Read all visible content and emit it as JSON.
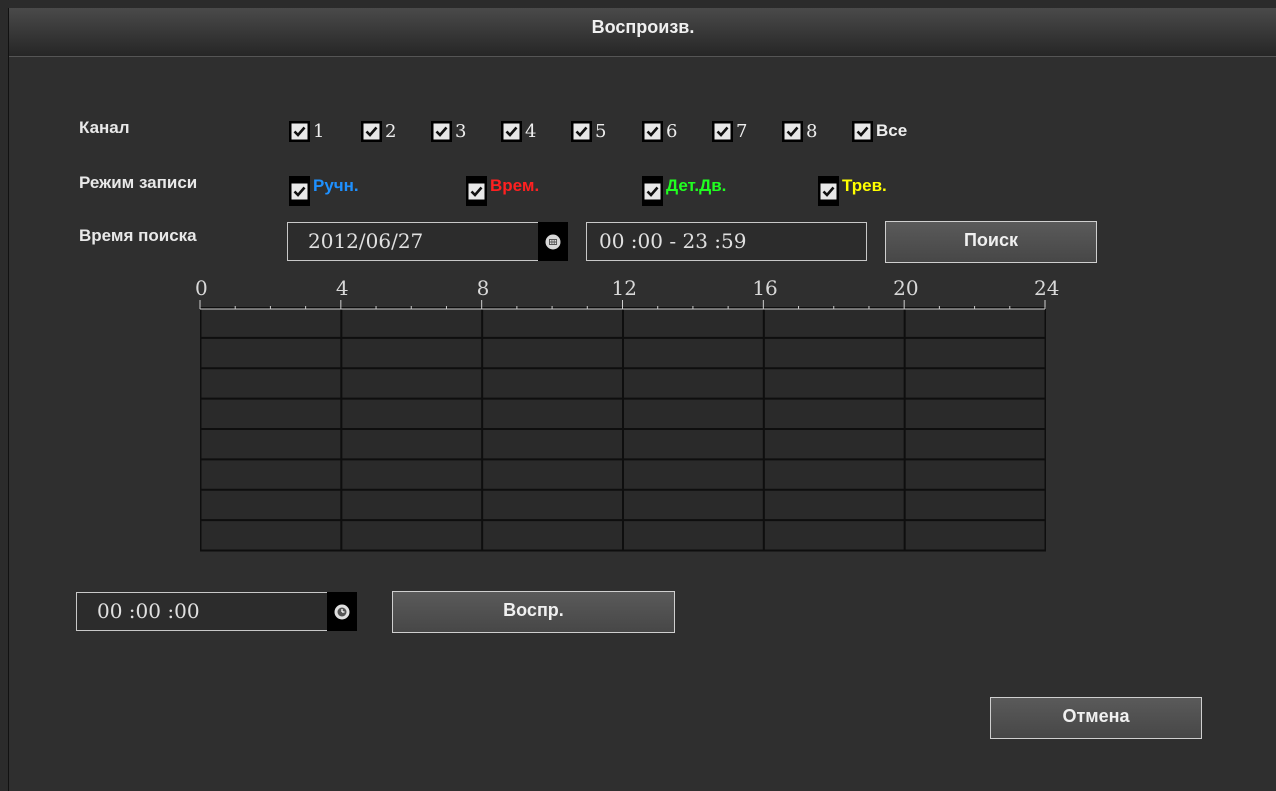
{
  "window": {
    "title": "Воспроизв."
  },
  "channel": {
    "label": "Канал",
    "items": [
      {
        "label": "1",
        "checked": true
      },
      {
        "label": "2",
        "checked": true
      },
      {
        "label": "3",
        "checked": true
      },
      {
        "label": "4",
        "checked": true
      },
      {
        "label": "5",
        "checked": true
      },
      {
        "label": "6",
        "checked": true
      },
      {
        "label": "7",
        "checked": true
      },
      {
        "label": "8",
        "checked": true
      },
      {
        "label": "Все",
        "checked": true
      }
    ]
  },
  "record_mode": {
    "label": "Режим записи",
    "items": [
      {
        "label": "Ручн.",
        "color": "#1e90ff",
        "checked": true
      },
      {
        "label": "Врем.",
        "color": "#ff2020",
        "checked": true
      },
      {
        "label": "Дет.Дв.",
        "color": "#20ff20",
        "checked": true
      },
      {
        "label": "Трев.",
        "color": "#ffff00",
        "checked": true
      }
    ]
  },
  "search_time": {
    "label": "Время поиска",
    "date": "2012/06/27",
    "time_range": "00 :00 - 23 :59",
    "search_button": "Поиск"
  },
  "timeline": {
    "ticks": [
      "0",
      "4",
      "8",
      "12",
      "16",
      "20",
      "24"
    ],
    "rows": 8
  },
  "playback": {
    "time": "00 :00 :00",
    "play_button": "Воспр."
  },
  "cancel_button": "Отмена",
  "icons": {
    "checkbox": "check-icon",
    "calendar": "calendar-icon",
    "clock": "clock-icon"
  }
}
